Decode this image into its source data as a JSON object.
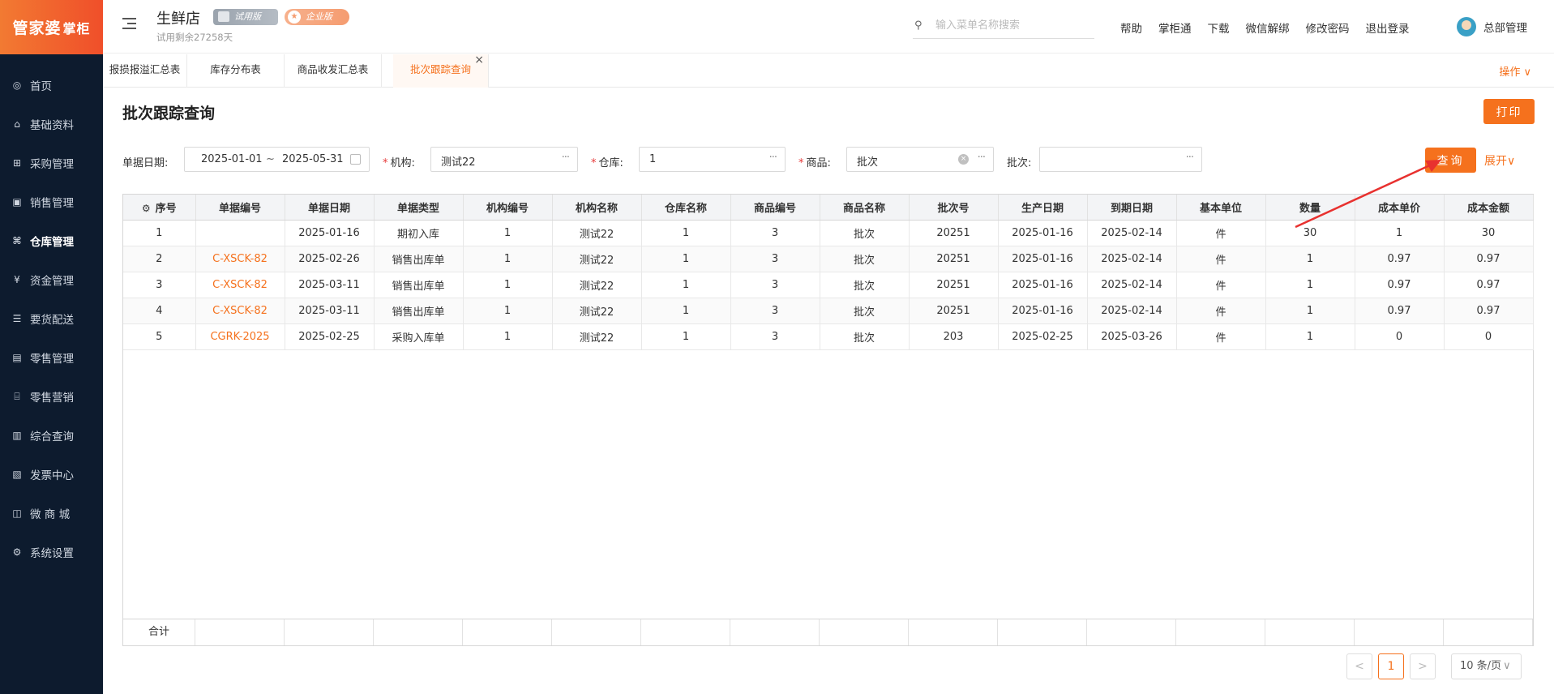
{
  "brand": {
    "logo_main": "管家婆",
    "logo_sub": "掌柜"
  },
  "sidebar": {
    "items": [
      {
        "label": "首页",
        "icon": "globe-icon",
        "glyph": "◎"
      },
      {
        "label": "基础资料",
        "icon": "home-icon",
        "glyph": "⌂"
      },
      {
        "label": "采购管理",
        "icon": "cart-icon",
        "glyph": "⊞"
      },
      {
        "label": "销售管理",
        "icon": "sales-icon",
        "glyph": "▣"
      },
      {
        "label": "仓库管理",
        "icon": "warehouse-icon",
        "glyph": "⌘",
        "active": true
      },
      {
        "label": "资金管理",
        "icon": "money-icon",
        "glyph": "¥"
      },
      {
        "label": "要货配送",
        "icon": "delivery-icon",
        "glyph": "☰"
      },
      {
        "label": "零售管理",
        "icon": "retail-icon",
        "glyph": "▤"
      },
      {
        "label": "零售营销",
        "icon": "gift-icon",
        "glyph": "⌸"
      },
      {
        "label": "综合查询",
        "icon": "chart-icon",
        "glyph": "▥"
      },
      {
        "label": "发票中心",
        "icon": "invoice-icon",
        "glyph": "▧"
      },
      {
        "label": "微 商 城",
        "icon": "bag-icon",
        "glyph": "◫"
      },
      {
        "label": "系统设置",
        "icon": "gear-icon",
        "glyph": "⚙"
      }
    ]
  },
  "header": {
    "store_name": "生鲜店",
    "badge_trial": "试用版",
    "badge_enterprise": "企业版",
    "trial_left": "试用剩余27258天",
    "search_placeholder": "输入菜单名称搜索",
    "links": [
      "帮助",
      "掌柜通",
      "下载",
      "微信解绑",
      "修改密码",
      "退出登录"
    ],
    "user": "总部管理"
  },
  "tabs": [
    {
      "label": "报损报溢汇总表"
    },
    {
      "label": "库存分布表"
    },
    {
      "label": "商品收发汇总表"
    },
    {
      "label": "批次跟踪查询",
      "active": true
    }
  ],
  "ops_label": "操作 ∨",
  "page": {
    "title": "批次跟踪查询",
    "print_label": "打印",
    "query_label": "查询",
    "expand_label": "展开∨"
  },
  "filters": {
    "date_label": "单据日期:",
    "date_from": "2025-01-01",
    "date_to": "2025-05-31",
    "org_label": "机构:",
    "org_value": "测试22",
    "wh_label": "仓库:",
    "wh_value": "1",
    "goods_label": "商品:",
    "goods_value": "批次",
    "batch_label": "批次:",
    "batch_value": ""
  },
  "table": {
    "headers": [
      "序号",
      "单据编号",
      "单据日期",
      "单据类型",
      "机构编号",
      "机构名称",
      "仓库名称",
      "商品编号",
      "商品名称",
      "批次号",
      "生产日期",
      "到期日期",
      "基本单位",
      "数量",
      "成本单价",
      "成本金额"
    ],
    "rows": [
      [
        "1",
        "",
        "2025-01-16",
        "期初入库",
        "1",
        "测试22",
        "1",
        "3",
        "批次",
        "20251",
        "2025-01-16",
        "2025-02-14",
        "件",
        "30",
        "1",
        "30"
      ],
      [
        "2",
        "C-XSCK-82",
        "2025-02-26",
        "销售出库单",
        "1",
        "测试22",
        "1",
        "3",
        "批次",
        "20251",
        "2025-01-16",
        "2025-02-14",
        "件",
        "1",
        "0.97",
        "0.97"
      ],
      [
        "3",
        "C-XSCK-82",
        "2025-03-11",
        "销售出库单",
        "1",
        "测试22",
        "1",
        "3",
        "批次",
        "20251",
        "2025-01-16",
        "2025-02-14",
        "件",
        "1",
        "0.97",
        "0.97"
      ],
      [
        "4",
        "C-XSCK-82",
        "2025-03-11",
        "销售出库单",
        "1",
        "测试22",
        "1",
        "3",
        "批次",
        "20251",
        "2025-01-16",
        "2025-02-14",
        "件",
        "1",
        "0.97",
        "0.97"
      ],
      [
        "5",
        "CGRK-2025",
        "2025-02-25",
        "采购入库单",
        "1",
        "测试22",
        "1",
        "3",
        "批次",
        "203",
        "2025-02-25",
        "2025-03-26",
        "件",
        "1",
        "0",
        "0"
      ]
    ],
    "total_label": "合计"
  },
  "pagination": {
    "prev": "<",
    "current": "1",
    "next": ">",
    "page_size": "10 条/页"
  },
  "colors": {
    "accent": "#f5711d",
    "sidebar_bg": "#0d1b2e"
  }
}
